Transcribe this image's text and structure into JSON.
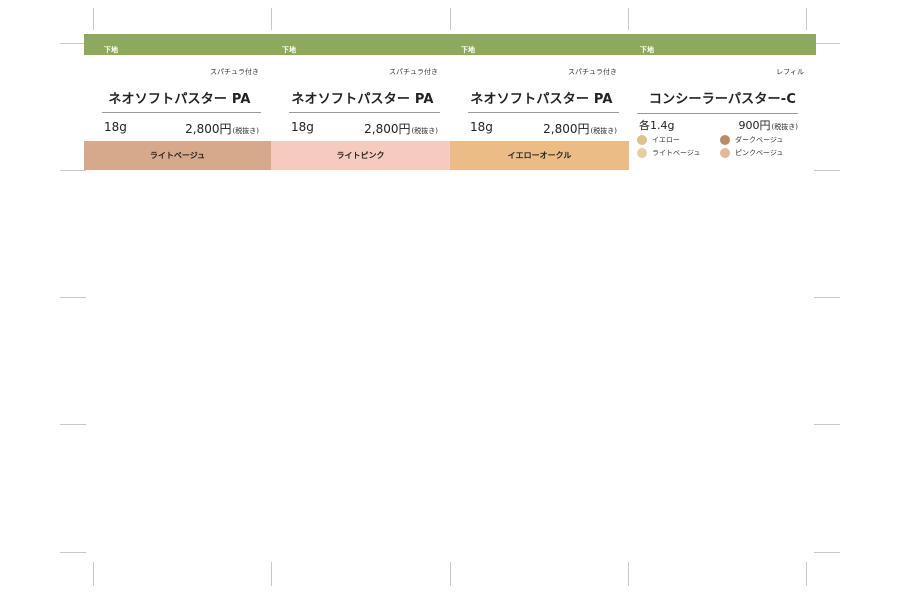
{
  "columns": [
    {
      "category": "下地",
      "note": "スパチュラ付き",
      "product_name": "ネオソフトパスター PA",
      "weight": "18g",
      "price": "2,800円",
      "tax_note": "(税抜き)",
      "shade": "ライトベージュ",
      "shade_color": "#d6a98c"
    },
    {
      "category": "下地",
      "note": "スパチュラ付き",
      "product_name": "ネオソフトパスター PA",
      "weight": "18g",
      "price": "2,800円",
      "tax_note": "(税抜き)",
      "shade": "ライトピンク",
      "shade_color": "#f5cbbe"
    },
    {
      "category": "下地",
      "note": "スパチュラ付き",
      "product_name": "ネオソフトパスター PA",
      "weight": "18g",
      "price": "2,800円",
      "tax_note": "(税抜き)",
      "shade": "イエローオークル",
      "shade_color": "#ebbc85"
    }
  ],
  "refill": {
    "category": "下地",
    "note": "レフィル",
    "product_name": "コンシーラーパスター-C",
    "weight": "各1.4g",
    "price": "900円",
    "tax_note": "(税抜き)",
    "shades": [
      {
        "label": "イエロー",
        "color": "#dcc18a"
      },
      {
        "label": "ダークベージュ",
        "color": "#b98b63"
      },
      {
        "label": "ライトベージュ",
        "color": "#e8cda5"
      },
      {
        "label": "ピンクベージュ",
        "color": "#e3b99e"
      }
    ]
  },
  "colors": {
    "header_green": "#8ca95d",
    "crop_mark": "#c8c8c8"
  }
}
